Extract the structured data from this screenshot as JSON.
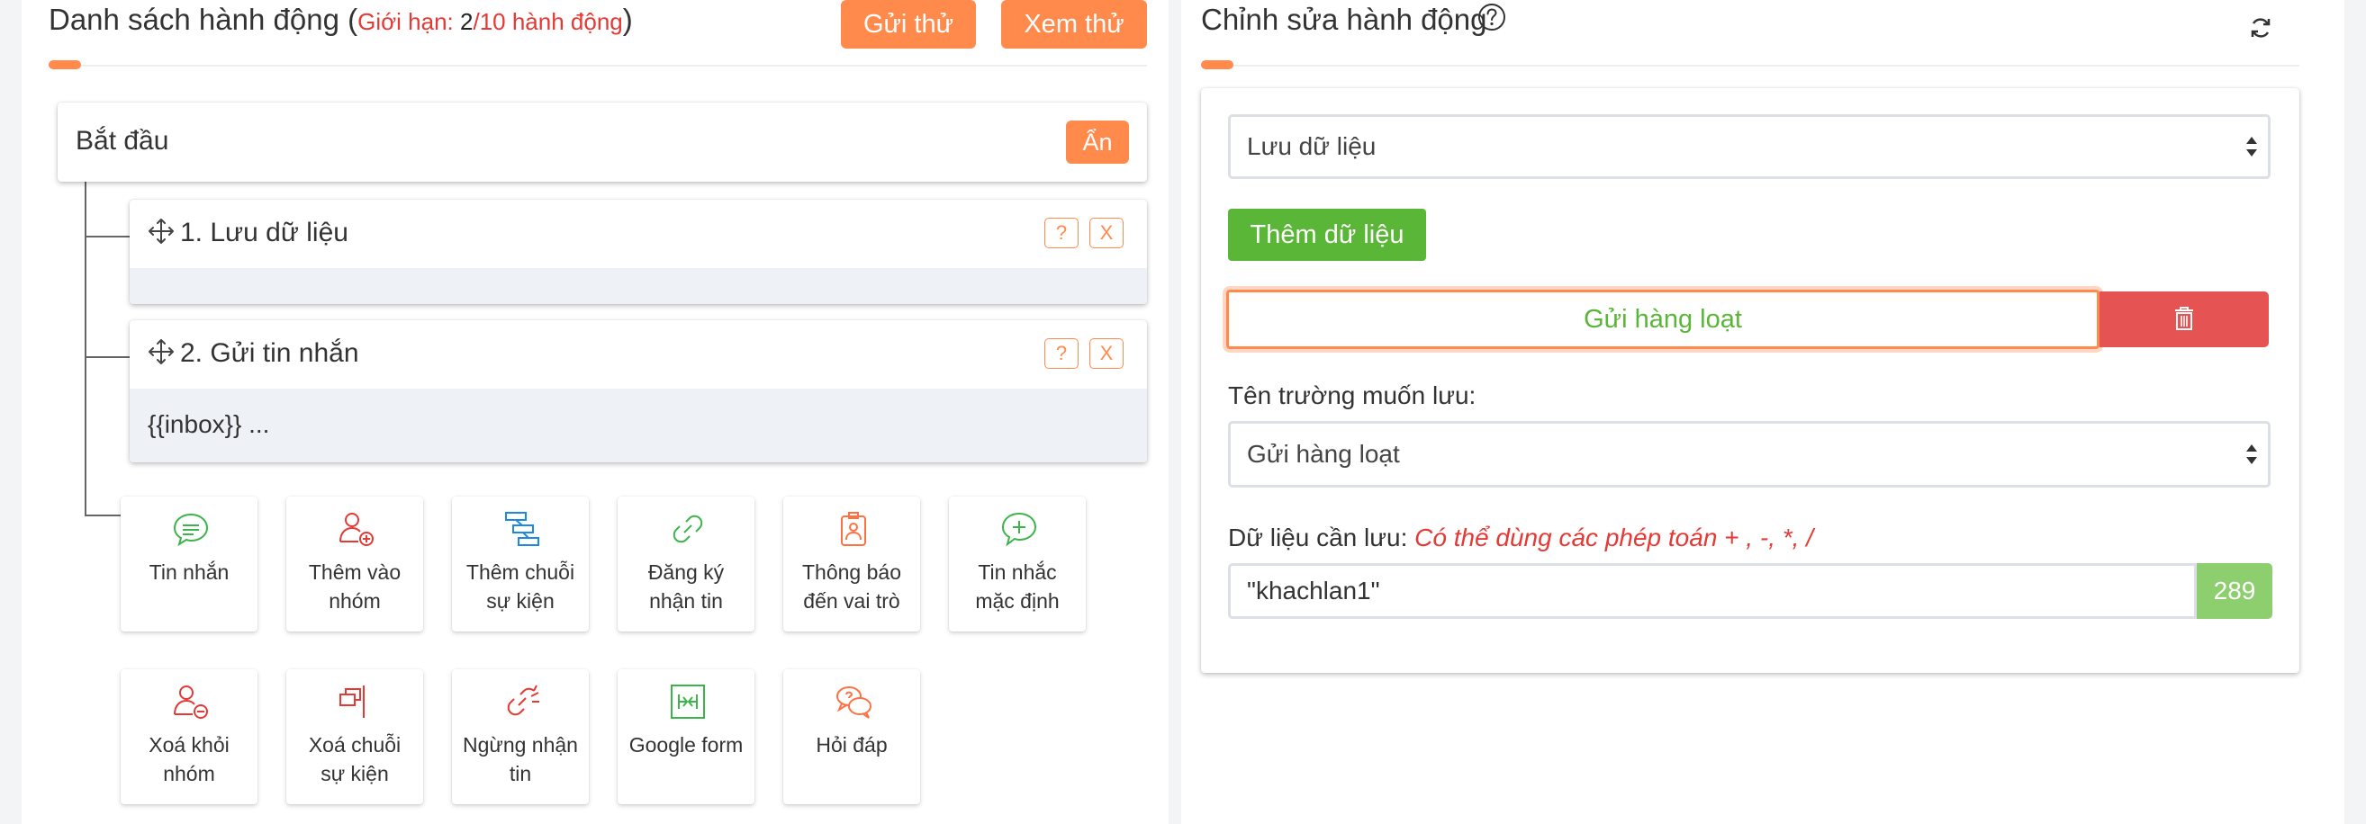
{
  "actions_list": {
    "title": "Danh sách hành động",
    "limit_prefix": "Giới hạn: ",
    "limit_current": "2",
    "limit_suffix": "/10 hành động",
    "send_test_label": "Gửi thử",
    "preview_label": "Xem thử"
  },
  "start_node": {
    "title": "Bắt đầu",
    "hide_label": "Ẩn"
  },
  "steps": [
    {
      "title": "1. Lưu dữ liệu",
      "subtitle": "",
      "help_label": "?",
      "close_label": "X"
    },
    {
      "title": "2. Gửi tin nhắn",
      "subtitle": "{{inbox}} ...",
      "help_label": "?",
      "close_label": "X"
    }
  ],
  "action_types": [
    {
      "icon": "chat-bubble-icon",
      "line1": "Tin nhắn",
      "line2": ""
    },
    {
      "icon": "add-user-icon",
      "line1": "Thêm vào",
      "line2": "nhóm"
    },
    {
      "icon": "sequence-icon",
      "line1": "Thêm chuỗi",
      "line2": "sự kiện"
    },
    {
      "icon": "subscribe-link-icon",
      "line1": "Đăng ký",
      "line2": "nhận tin"
    },
    {
      "icon": "badge-notify-icon",
      "line1": "Thông báo",
      "line2": "đến vai trò"
    },
    {
      "icon": "chat-plus-icon",
      "line1": "Tin nhắc",
      "line2": "mặc định"
    },
    {
      "icon": "remove-user-icon",
      "line1": "Xoá khỏi",
      "line2": "nhóm"
    },
    {
      "icon": "remove-sequence-icon",
      "line1": "Xoá chuỗi",
      "line2": "sự kiện"
    },
    {
      "icon": "unsubscribe-icon",
      "line1": "Ngừng nhận",
      "line2": "tin"
    },
    {
      "icon": "google-form-icon",
      "line1": "Google form",
      "line2": ""
    },
    {
      "icon": "qa-chat-icon",
      "line1": "Hỏi đáp",
      "line2": ""
    }
  ],
  "editor": {
    "title": "Chỉnh sửa hành động",
    "action_select_value": "Lưu dữ liệu",
    "add_data_label": "Thêm dữ liệu",
    "tag_value": "Gửi hàng loạt",
    "field_label": "Tên trường muốn lưu:",
    "field_select_value": "Gửi hàng loạt",
    "data_label": "Dữ liệu cần lưu:",
    "data_hint": "Có thể dùng các phép toán + , -, *, /",
    "data_value": "\"khachlan1\"",
    "char_count": "289"
  },
  "colors": {
    "accent": "#ff8a4c",
    "danger": "#e55353",
    "success": "#5ab636",
    "counter": "#8dcf6f"
  }
}
